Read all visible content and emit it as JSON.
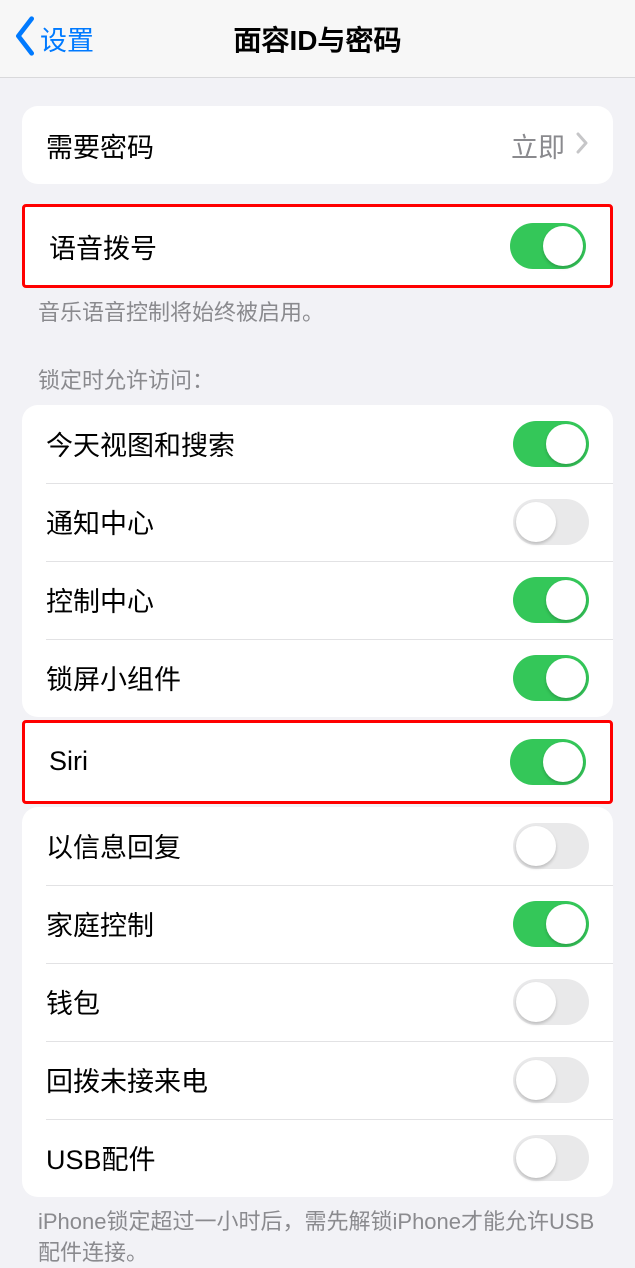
{
  "nav": {
    "back_label": "设置",
    "title": "面容ID与密码"
  },
  "require_passcode": {
    "label": "需要密码",
    "value": "立即"
  },
  "voice_dial": {
    "label": "语音拨号",
    "footer": "音乐语音控制将始终被启用。"
  },
  "lock_header": "锁定时允许访问：",
  "lock_items": {
    "today_view": "今天视图和搜索",
    "notification_center": "通知中心",
    "control_center": "控制中心",
    "lock_widgets": "锁屏小组件",
    "siri": "Siri",
    "message_reply": "以信息回复",
    "home_control": "家庭控制",
    "wallet": "钱包",
    "return_calls": "回拨未接来电",
    "usb_accessories": "USB配件"
  },
  "usb_footer": "iPhone锁定超过一小时后，需先解锁iPhone才能允许USB配件连接。"
}
